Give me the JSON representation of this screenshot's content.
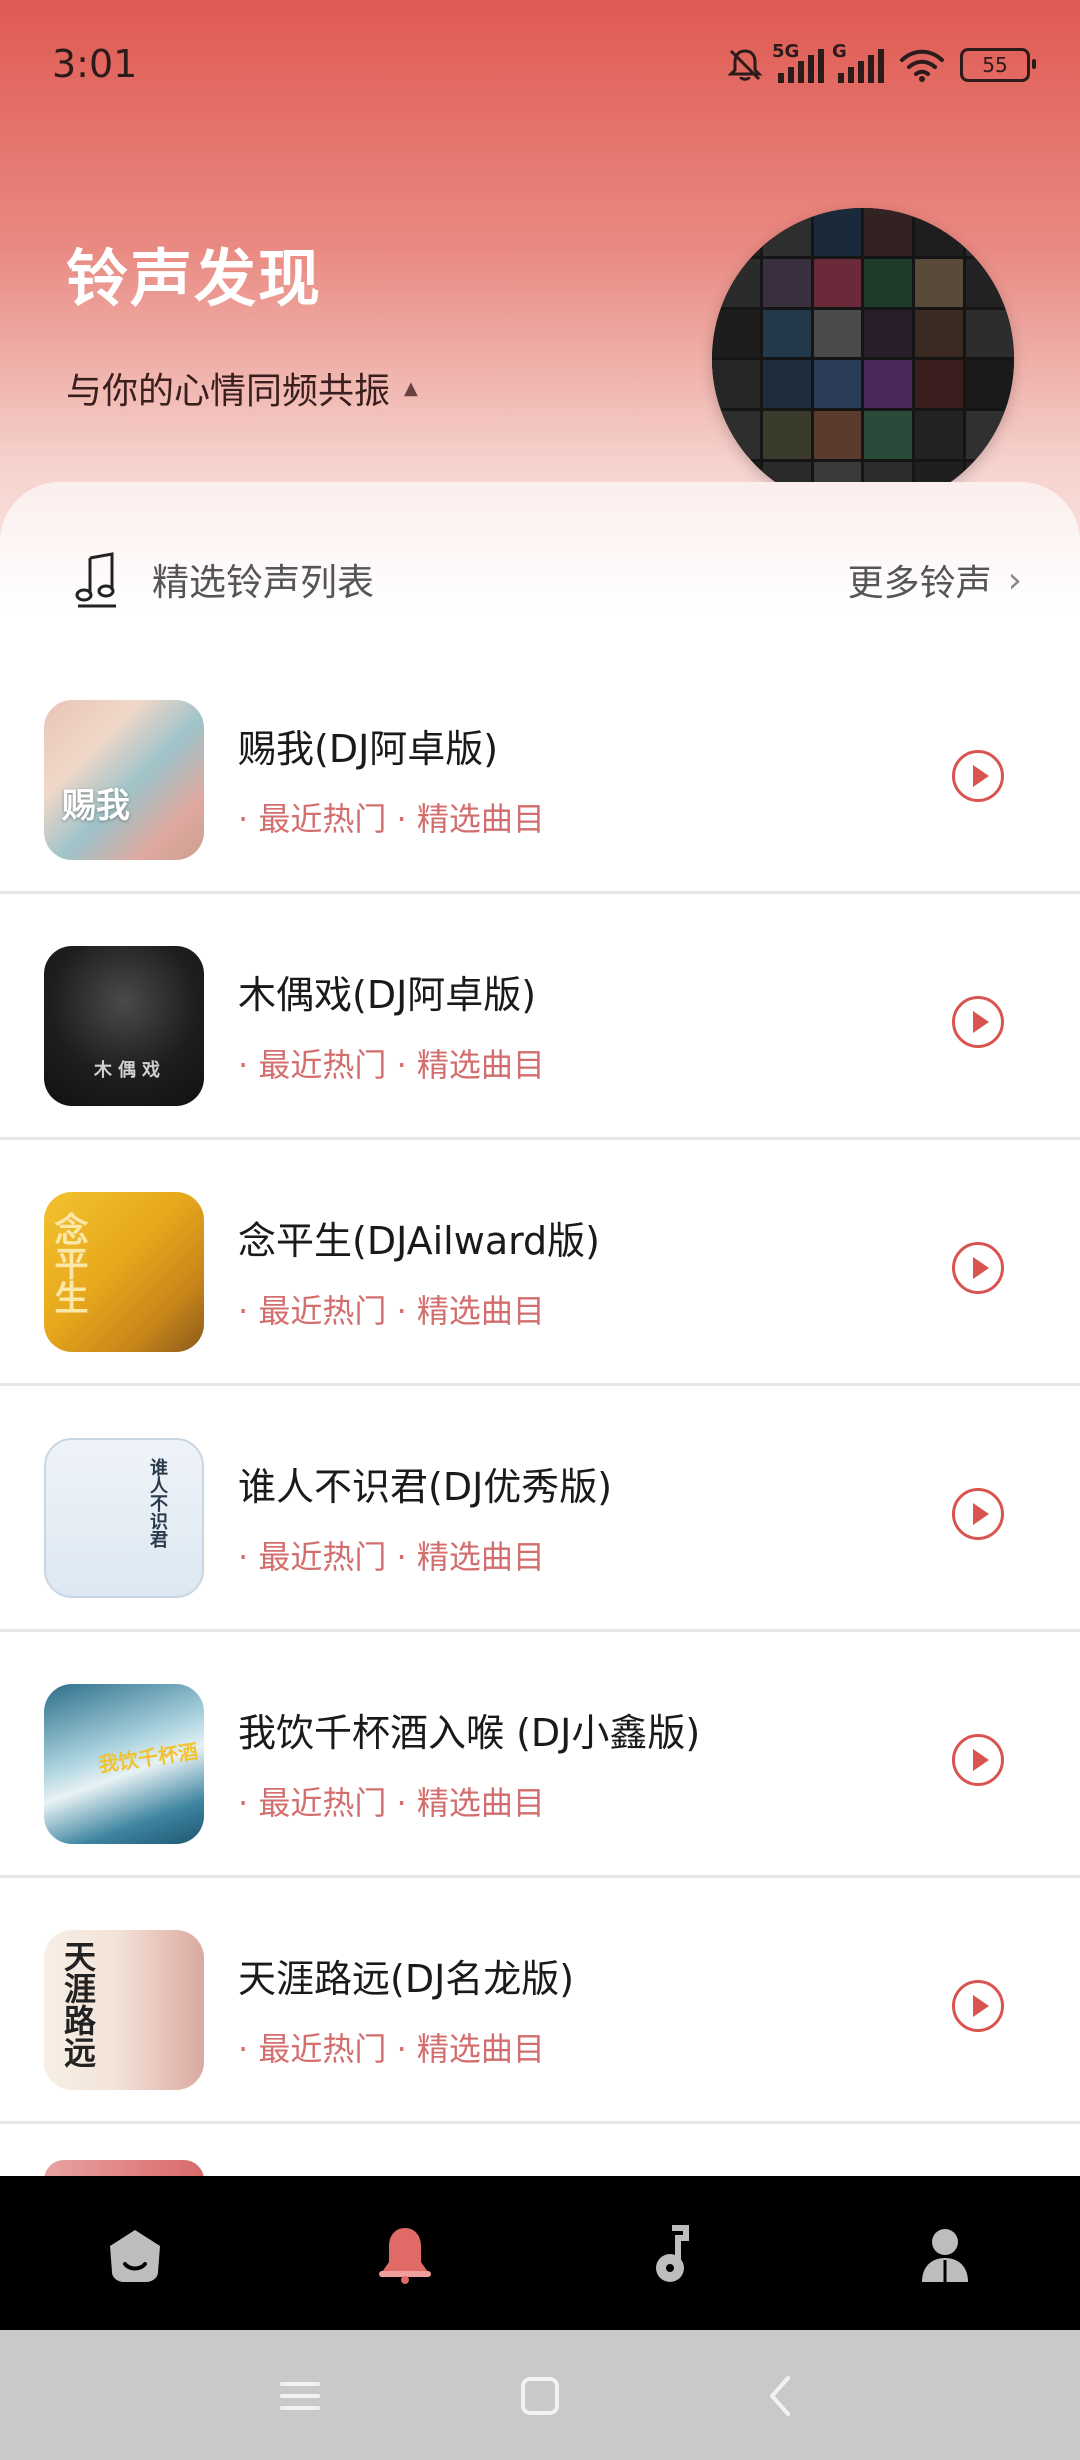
{
  "status_bar": {
    "time": "3:01",
    "network_1": "5G",
    "network_2": "G",
    "battery": "55"
  },
  "hero": {
    "title": "铃声发现",
    "subtitle": "与你的心情同频共振"
  },
  "section": {
    "title": "精选铃声列表",
    "more_label": "更多铃声"
  },
  "songs": [
    {
      "title": "赐我(DJ阿卓版)",
      "tags": "· 最近热门 · 精选曲目",
      "cover_text": "赐我"
    },
    {
      "title": "木偶戏(DJ阿卓版)",
      "tags": "· 最近热门 · 精选曲目",
      "cover_text": "木偶戏"
    },
    {
      "title": "念平生(DJAilward版)",
      "tags": "· 最近热门 · 精选曲目",
      "cover_text": "念平生"
    },
    {
      "title": "谁人不识君(DJ优秀版)",
      "tags": "· 最近热门 · 精选曲目",
      "cover_text": "谁人不识君"
    },
    {
      "title": "我饮千杯酒入喉 (DJ小鑫版)",
      "tags": "· 最近热门 · 精选曲目",
      "cover_text": "我饮千杯酒"
    },
    {
      "title": "天涯路远(DJ名龙版)",
      "tags": "· 最近热门 · 精选曲目",
      "cover_text": "天涯路远"
    }
  ],
  "tabs": [
    {
      "name": "home-icon"
    },
    {
      "name": "bell-icon",
      "active": true
    },
    {
      "name": "music-note-icon"
    },
    {
      "name": "profile-icon"
    }
  ],
  "colors": {
    "accent": "#d9534f",
    "tag_text": "#d36e6e",
    "header_top": "#df5a52",
    "tabbar": "#000000",
    "navbar": "#c9c9c9"
  }
}
